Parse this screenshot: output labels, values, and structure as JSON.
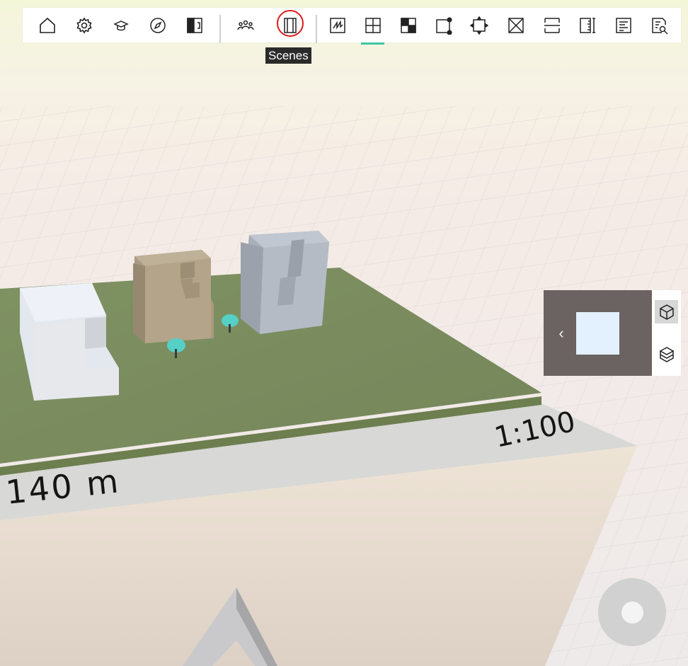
{
  "toolbar": {
    "items": [
      {
        "icon": "home-icon"
      },
      {
        "icon": "gear-icon"
      },
      {
        "icon": "graduation-cap-icon"
      },
      {
        "icon": "compass-icon"
      },
      {
        "icon": "split-view-icon"
      },
      {
        "icon": "people-icon"
      },
      {
        "icon": "scenes-icon"
      },
      {
        "icon": "sketch-icon"
      },
      {
        "icon": "draw-plan-icon"
      },
      {
        "icon": "checkerboard-icon"
      },
      {
        "icon": "select-shape-icon"
      },
      {
        "icon": "transform-icon"
      },
      {
        "icon": "remove-box-icon"
      },
      {
        "icon": "horizontal-section-icon"
      },
      {
        "icon": "measure-icon"
      },
      {
        "icon": "report-icon"
      },
      {
        "icon": "analyze-icon"
      }
    ],
    "active_item": "draw-plan-icon",
    "highlighted_item": "scenes-icon"
  },
  "tooltip": {
    "text": "Scenes"
  },
  "model": {
    "dimension_label": "140 m",
    "scale_label": "1:100"
  },
  "view_panel": {
    "prev_icon": "chevron-left-icon",
    "buttons": [
      {
        "icon": "cube-3d-icon",
        "active": true
      },
      {
        "icon": "layers-icon",
        "active": false
      }
    ]
  },
  "colors": {
    "accent": "#3cc7a2",
    "highlight_ring": "#e01a1a",
    "ground": "#7d8e60",
    "base": "#ebdfd2",
    "panel_dark": "#6b6361"
  }
}
